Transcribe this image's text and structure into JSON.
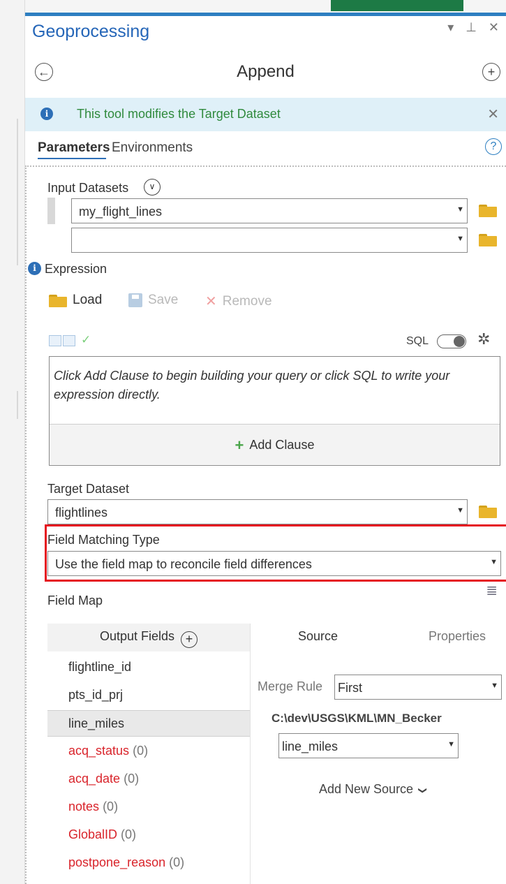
{
  "pane": {
    "title": "Geoprocessing",
    "controls": "▾ ⊥ ✕"
  },
  "tool": {
    "title": "Append",
    "back_glyph": "←",
    "add_glyph": "+"
  },
  "info_bar": {
    "message": "This tool modifies the Target Dataset",
    "icon_glyph": "i",
    "close_glyph": "✕"
  },
  "tabs": {
    "parameters": "Parameters",
    "environments": "Environments",
    "help_glyph": "?"
  },
  "input_datasets": {
    "label": "Input Datasets",
    "chevron_glyph": "∨",
    "rows": [
      {
        "value": "my_flight_lines"
      },
      {
        "value": ""
      }
    ]
  },
  "expression": {
    "label": "Expression",
    "icon_glyph": "i",
    "load_label": "Load",
    "save_label": "Save",
    "remove_label": "Remove",
    "remove_glyph": "✕",
    "check_glyph": "✓",
    "sql_label": "SQL",
    "gear_glyph": "✲",
    "query_hint": "Click Add Clause to begin building your query or click SQL to write your expression directly.",
    "add_clause_label": "Add Clause",
    "add_clause_glyph": "+"
  },
  "target_dataset": {
    "label": "Target Dataset",
    "value": "flightlines"
  },
  "field_matching": {
    "label": "Field Matching Type",
    "value": "Use the field map to reconcile field differences"
  },
  "field_map": {
    "label": "Field Map",
    "icon_glyph": "≣",
    "output_fields_header": "Output Fields",
    "add_field_glyph": "+",
    "fields": [
      {
        "name": "flightline_id",
        "count": ""
      },
      {
        "name": "pts_id_prj",
        "count": ""
      },
      {
        "name": "line_miles",
        "count": ""
      },
      {
        "name": "acq_status",
        "count": "(0)"
      },
      {
        "name": "acq_date",
        "count": "(0)"
      },
      {
        "name": "notes",
        "count": "(0)"
      },
      {
        "name": "GlobalID",
        "count": "(0)"
      },
      {
        "name": "postpone_reason",
        "count": "(0)"
      }
    ],
    "source_tab": "Source",
    "properties_tab": "Properties",
    "merge_rule_label": "Merge Rule",
    "merge_rule_value": "First",
    "source_path": "C:\\dev\\USGS\\KML\\MN_Becker",
    "source_field_value": "line_miles",
    "add_new_source_label": "Add New Source",
    "add_new_source_glyph": "❯"
  },
  "dropdown_arrow_glyph": "▼",
  "colors": {
    "title_blue": "#2566b8",
    "info_bg": "#dff0f8",
    "info_text": "#2f8a3d",
    "highlight_red": "#e5131f",
    "unmatched_field_red": "#d9242b",
    "folder_yellow": "#e9b52c",
    "add_clause_green": "#4aa54a"
  }
}
